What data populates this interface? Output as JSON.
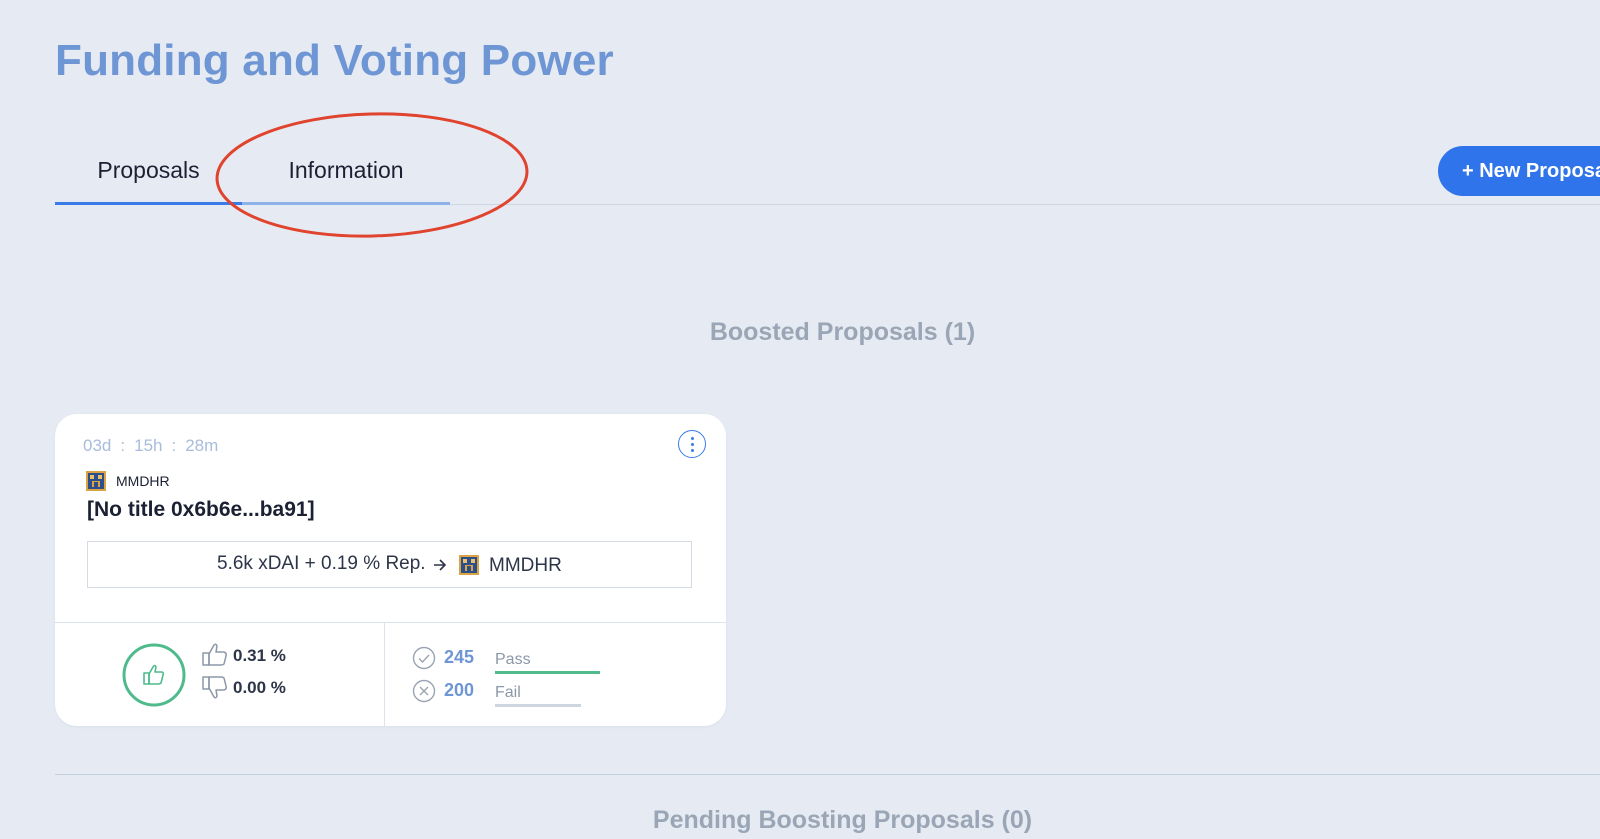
{
  "page": {
    "title": "Funding and Voting Power"
  },
  "tabs": [
    {
      "label": "Proposals",
      "active": true
    },
    {
      "label": "Information",
      "active": false
    }
  ],
  "toolbar": {
    "new_proposal_label": "+ New Proposal"
  },
  "sections": {
    "boosted": "Boosted Proposals (1)",
    "pending": "Pending Boosting Proposals (0)"
  },
  "proposal": {
    "countdown": {
      "days": "03d",
      "hours": "15h",
      "minutes": "28m",
      "separator": ":"
    },
    "dao_name": "MMDHR",
    "title": "[No title 0x6b6e...ba91]",
    "reward": "5.6k xDAI + 0.19 % Rep.",
    "reward_recipient": "MMDHR",
    "votes": {
      "for": "0.31 %",
      "against": "0.00 %"
    },
    "stakes": {
      "pass_value": "245",
      "pass_label": "Pass",
      "fail_value": "200",
      "fail_label": "Fail"
    }
  },
  "colors": {
    "accent": "#2f74ea",
    "title": "#6f96d4",
    "pass": "#4fbb8c",
    "fail_bar": "#cfd6e0",
    "annotation": "#e0442e",
    "background": "#e6ebf3"
  },
  "icons": {
    "vote_circle": "thumbs-up-icon",
    "for": "thumbs-up-icon",
    "against": "thumbs-down-icon",
    "pass": "check-circle-icon",
    "fail": "x-circle-icon",
    "menu": "more-vertical-icon"
  }
}
